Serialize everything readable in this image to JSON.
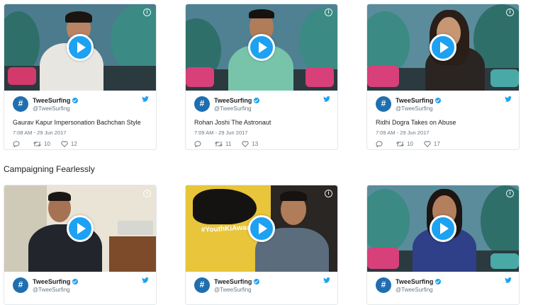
{
  "section": {
    "title": "Campaigning Fearlessly"
  },
  "cards": [
    {
      "name": "TweeSurfing",
      "handle": "@TweeSurfing",
      "text": "Gaurav Kapur Impersonation Bachchan Style",
      "time": "7:08 AM - 29 Jun 2017",
      "retweets": "10",
      "likes": "12"
    },
    {
      "name": "TweeSurfing",
      "handle": "@TweeSurfing",
      "text": "Rohan Joshi The Astronaut",
      "time": "7:09 AM - 29 Jun 2017",
      "retweets": "11",
      "likes": "13"
    },
    {
      "name": "TweeSurfing",
      "handle": "@TweeSurfing",
      "text": "Ridhi Dogra Takes on Abuse",
      "time": "7:09 AM - 29 Jun 2017",
      "retweets": "10",
      "likes": "17"
    },
    {
      "name": "TweeSurfing",
      "handle": "@TweeSurfing",
      "thumb_text": "#YouthKiAwaaz"
    },
    {
      "name": "TweeSurfing",
      "handle": "@TweeSurfing",
      "thumb_text": ""
    },
    {
      "name": "TweeSurfing",
      "handle": "@TweeSurfing",
      "thumb_text": ""
    }
  ],
  "colors": {
    "twitter_blue": "#1da1f2",
    "border": "#e1e8ed",
    "muted": "#697882"
  },
  "icons": [
    "info-icon",
    "play-icon",
    "twitter-bird-icon",
    "verified-icon",
    "reply-icon",
    "retweet-icon",
    "heart-icon"
  ]
}
